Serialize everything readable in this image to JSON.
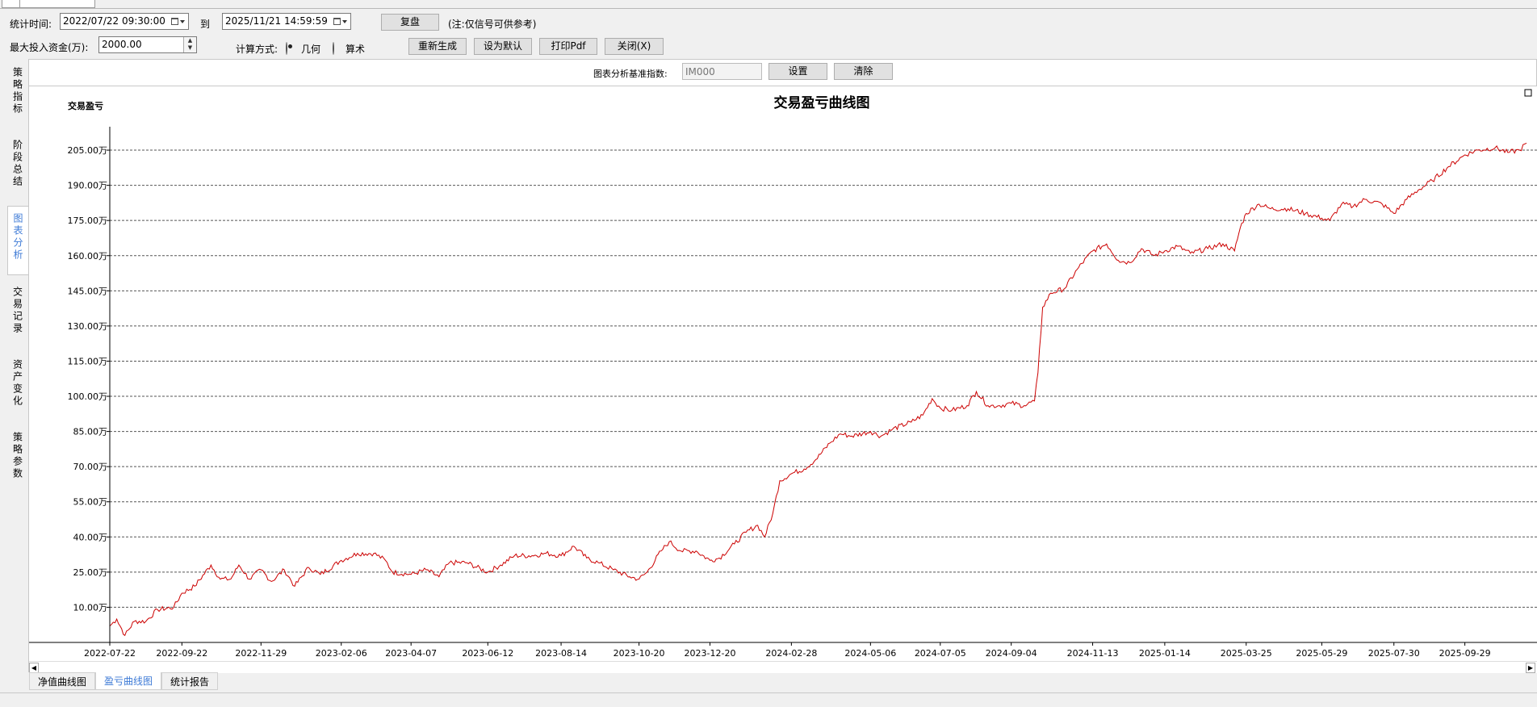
{
  "window_tabs": [
    "",
    ""
  ],
  "toolbar": {
    "stat_time_label": "统计时间:",
    "start_datetime": "2022/07/22 09:30:00",
    "to_label": "到",
    "end_datetime": "2025/11/21 14:59:59",
    "replay_button": "复盘",
    "note": "(注:仅信号可供参考)",
    "max_capital_label": "最大投入资金(万):",
    "max_capital_value": "2000.00",
    "calc_method_label": "计算方式:",
    "calc_options": [
      "几何",
      "算术"
    ],
    "calc_selected": "几何",
    "regenerate_button": "重新生成",
    "set_default_button": "设为默认",
    "print_pdf_button": "打印Pdf",
    "close_button": "关闭(X)"
  },
  "sidebar": {
    "items": [
      {
        "label": "策略指标",
        "selected": false
      },
      {
        "label": "阶段总结",
        "selected": false
      },
      {
        "label": "图表分析",
        "selected": true
      },
      {
        "label": "交易记录",
        "selected": false
      },
      {
        "label": "资产变化",
        "selected": false
      },
      {
        "label": "策略参数",
        "selected": false
      }
    ]
  },
  "benchmark": {
    "label": "图表分析基准指数:",
    "placeholder": "IM000",
    "set_button": "设置",
    "clear_button": "清除"
  },
  "bottom_tabs": [
    {
      "label": "净值曲线图",
      "selected": false
    },
    {
      "label": "盈亏曲线图",
      "selected": true
    },
    {
      "label": "统计报告",
      "selected": false
    }
  ],
  "chart_data": {
    "type": "line",
    "title": "交易盈亏曲线图",
    "ylabel": "交易盈亏",
    "xlabel": "",
    "y_ticks": [
      "10.00万",
      "25.00万",
      "40.00万",
      "55.00万",
      "70.00万",
      "85.00万",
      "100.00万",
      "115.00万",
      "130.00万",
      "145.00万",
      "160.00万",
      "175.00万",
      "190.00万",
      "205.00万"
    ],
    "x_ticks": [
      "2022-07-22",
      "2022-09-22",
      "2022-11-29",
      "2023-02-06",
      "2023-04-07",
      "2023-06-12",
      "2023-08-14",
      "2023-10-20",
      "2023-12-20",
      "2024-02-28",
      "2024-05-06",
      "2024-07-05",
      "2024-09-04",
      "2024-11-13",
      "2025-01-14",
      "2025-03-25",
      "2025-05-29",
      "2025-07-30",
      "2025-09-29"
    ],
    "ylim": [
      -5,
      215
    ],
    "grid": "horizontal-dashed",
    "color": "#cc0000",
    "series": [
      {
        "values": [
          [
            "2022-07-22",
            2
          ],
          [
            "2022-07-28",
            5
          ],
          [
            "2022-08-04",
            -2
          ],
          [
            "2022-08-12",
            4
          ],
          [
            "2022-08-22",
            4
          ],
          [
            "2022-09-01",
            9
          ],
          [
            "2022-09-15",
            10
          ],
          [
            "2022-09-22",
            16
          ],
          [
            "2022-10-03",
            19
          ],
          [
            "2022-10-17",
            28
          ],
          [
            "2022-10-25",
            22
          ],
          [
            "2022-11-03",
            22
          ],
          [
            "2022-11-10",
            28
          ],
          [
            "2022-11-19",
            22
          ],
          [
            "2022-11-29",
            26
          ],
          [
            "2022-12-08",
            21
          ],
          [
            "2022-12-19",
            26
          ],
          [
            "2022-12-28",
            19
          ],
          [
            "2023-01-09",
            27
          ],
          [
            "2023-01-19",
            24
          ],
          [
            "2023-02-06",
            30
          ],
          [
            "2023-02-20",
            33
          ],
          [
            "2023-03-06",
            33
          ],
          [
            "2023-03-16",
            30
          ],
          [
            "2023-03-22",
            25
          ],
          [
            "2023-04-07",
            24
          ],
          [
            "2023-04-20",
            26
          ],
          [
            "2023-05-01",
            23
          ],
          [
            "2023-05-10",
            29
          ],
          [
            "2023-05-25",
            29
          ],
          [
            "2023-06-12",
            25
          ],
          [
            "2023-06-23",
            28
          ],
          [
            "2023-07-05",
            32
          ],
          [
            "2023-07-20",
            32
          ],
          [
            "2023-08-01",
            33
          ],
          [
            "2023-08-14",
            32
          ],
          [
            "2023-08-25",
            36
          ],
          [
            "2023-09-05",
            31
          ],
          [
            "2023-09-15",
            29
          ],
          [
            "2023-09-28",
            26
          ],
          [
            "2023-10-12",
            23
          ],
          [
            "2023-10-20",
            22
          ],
          [
            "2023-10-27",
            25
          ],
          [
            "2023-11-08",
            34
          ],
          [
            "2023-11-15",
            38
          ],
          [
            "2023-11-25",
            34
          ],
          [
            "2023-12-08",
            34
          ],
          [
            "2023-12-20",
            30
          ],
          [
            "2023-12-28",
            31
          ],
          [
            "2024-01-10",
            37
          ],
          [
            "2024-01-20",
            42
          ],
          [
            "2024-01-30",
            45
          ],
          [
            "2024-02-05",
            40
          ],
          [
            "2024-02-12",
            50
          ],
          [
            "2024-02-18",
            64
          ],
          [
            "2024-02-28",
            67
          ],
          [
            "2024-03-10",
            69
          ],
          [
            "2024-03-20",
            73
          ],
          [
            "2024-04-01",
            80
          ],
          [
            "2024-04-10",
            84
          ],
          [
            "2024-04-20",
            83
          ],
          [
            "2024-05-06",
            85
          ],
          [
            "2024-05-15",
            83
          ],
          [
            "2024-05-25",
            86
          ],
          [
            "2024-06-10",
            89
          ],
          [
            "2024-06-20",
            92
          ],
          [
            "2024-06-28",
            99
          ],
          [
            "2024-07-05",
            95
          ],
          [
            "2024-07-15",
            94
          ],
          [
            "2024-07-28",
            96
          ],
          [
            "2024-08-05",
            102
          ],
          [
            "2024-08-15",
            96
          ],
          [
            "2024-08-25",
            96
          ],
          [
            "2024-09-04",
            97
          ],
          [
            "2024-09-15",
            96
          ],
          [
            "2024-09-24",
            98
          ],
          [
            "2024-09-27",
            110
          ],
          [
            "2024-10-01",
            138
          ],
          [
            "2024-10-08",
            144
          ],
          [
            "2024-10-20",
            146
          ],
          [
            "2024-11-01",
            155
          ],
          [
            "2024-11-13",
            162
          ],
          [
            "2024-11-25",
            165
          ],
          [
            "2024-12-05",
            158
          ],
          [
            "2024-12-15",
            157
          ],
          [
            "2024-12-25",
            163
          ],
          [
            "2025-01-05",
            160
          ],
          [
            "2025-01-14",
            162
          ],
          [
            "2025-01-25",
            164
          ],
          [
            "2025-02-05",
            161
          ],
          [
            "2025-02-20",
            163
          ],
          [
            "2025-03-05",
            165
          ],
          [
            "2025-03-15",
            162
          ],
          [
            "2025-03-20",
            172
          ],
          [
            "2025-03-25",
            178
          ],
          [
            "2025-04-05",
            182
          ],
          [
            "2025-04-15",
            180
          ],
          [
            "2025-04-30",
            180
          ],
          [
            "2025-05-15",
            178
          ],
          [
            "2025-05-29",
            176
          ],
          [
            "2025-06-05",
            175
          ],
          [
            "2025-06-15",
            182
          ],
          [
            "2025-06-25",
            181
          ],
          [
            "2025-07-05",
            184
          ],
          [
            "2025-07-20",
            182
          ],
          [
            "2025-07-30",
            178
          ],
          [
            "2025-08-10",
            184
          ],
          [
            "2025-08-20",
            188
          ],
          [
            "2025-09-01",
            192
          ],
          [
            "2025-09-15",
            198
          ],
          [
            "2025-09-29",
            203
          ],
          [
            "2025-10-10",
            205
          ],
          [
            "2025-10-25",
            206
          ],
          [
            "2025-11-05",
            204
          ],
          [
            "2025-11-15",
            205
          ],
          [
            "2025-11-21",
            208
          ]
        ]
      }
    ]
  }
}
